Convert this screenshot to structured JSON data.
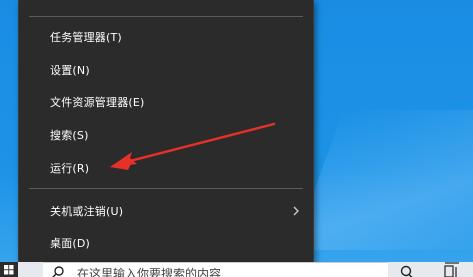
{
  "menu": {
    "top_partial": "",
    "items": [
      {
        "label": "任务管理器(T)"
      },
      {
        "label": "设置(N)"
      },
      {
        "label": "文件资源管理器(E)"
      },
      {
        "label": "搜索(S)"
      },
      {
        "label": "运行(R)"
      },
      {
        "label": "关机或注销(U)",
        "has_submenu": true
      },
      {
        "label": "桌面(D)"
      }
    ]
  },
  "taskbar": {
    "search_placeholder": "在这里输入你要搜索的内容",
    "start_icon": "windows-logo-icon",
    "search_icon": "search-icon",
    "task_view_icon": "task-view-icon"
  },
  "annotation": {
    "arrow_color": "#e8302a",
    "points_to": "运行(R)"
  },
  "colors": {
    "menu_bg": "#2b2b2b",
    "menu_text": "#ffffff",
    "desktop": "#1c8fe3",
    "taskbar": "#e6eaef"
  }
}
